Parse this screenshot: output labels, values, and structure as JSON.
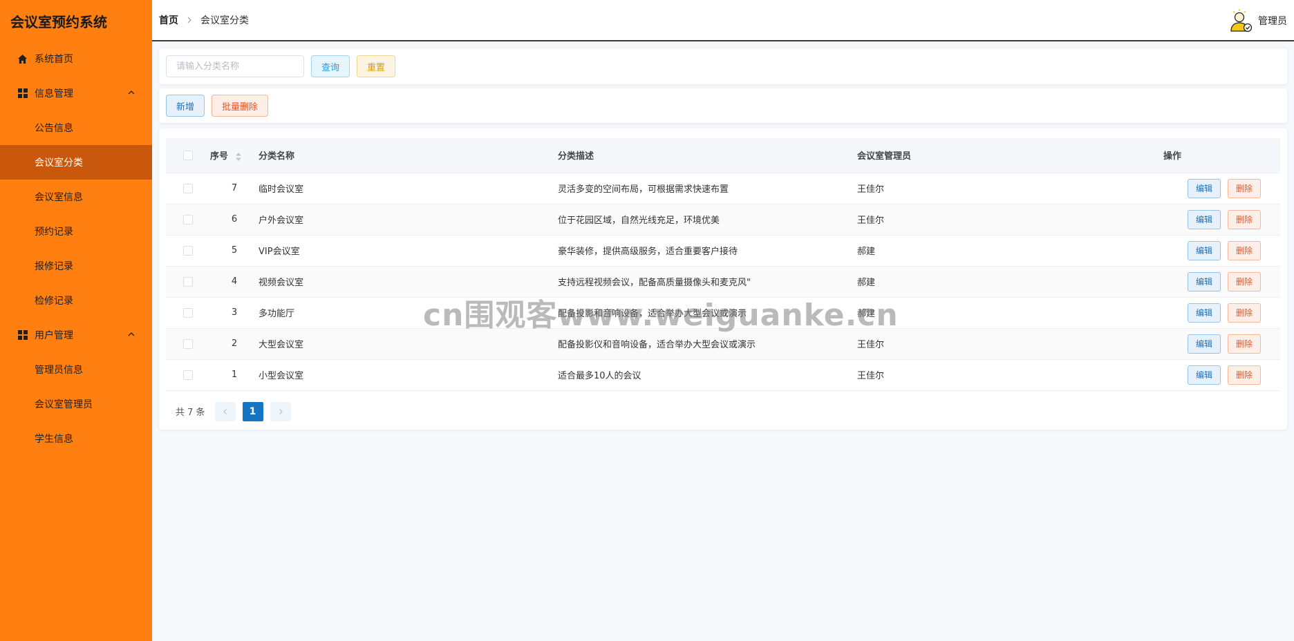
{
  "sidebar": {
    "logo": "会议室预约系统",
    "home": "系统首页",
    "groups": [
      {
        "label": "信息管理",
        "items": [
          "公告信息",
          "会议室分类",
          "会议室信息",
          "预约记录",
          "报修记录",
          "检修记录"
        ]
      },
      {
        "label": "用户管理",
        "items": [
          "管理员信息",
          "会议室管理员",
          "学生信息"
        ]
      }
    ],
    "active_item": "会议室分类"
  },
  "header": {
    "breadcrumb_home": "首页",
    "breadcrumb_current": "会议室分类",
    "user_name": "管理员",
    "user_icon": "avatar-icon"
  },
  "search": {
    "placeholder": "请输入分类名称",
    "value": "",
    "query_label": "查询",
    "reset_label": "重置"
  },
  "actions": {
    "add_label": "新增",
    "batch_delete_label": "批量删除"
  },
  "table": {
    "headers": {
      "seq": "序号",
      "name": "分类名称",
      "desc": "分类描述",
      "manager": "会议室管理员",
      "ops": "操作"
    },
    "edit_label": "编辑",
    "delete_label": "删除",
    "rows": [
      {
        "seq": "7",
        "name": "临时会议室",
        "desc": "灵活多变的空间布局，可根据需求快速布置",
        "manager": "王佳尔"
      },
      {
        "seq": "6",
        "name": "户外会议室",
        "desc": "位于花园区域，自然光线充足，环境优美",
        "manager": "王佳尔"
      },
      {
        "seq": "5",
        "name": "VIP会议室",
        "desc": "豪华装修，提供高级服务，适合重要客户接待",
        "manager": "郝建"
      },
      {
        "seq": "4",
        "name": "视频会议室",
        "desc": "支持远程视频会议，配备高质量摄像头和麦克风\"",
        "manager": "郝建"
      },
      {
        "seq": "3",
        "name": "多功能厅",
        "desc": "配备投影和音响设备，适合举办大型会议或演示",
        "manager": "郝建"
      },
      {
        "seq": "2",
        "name": "大型会议室",
        "desc": "配备投影仪和音响设备，适合举办大型会议或演示",
        "manager": "王佳尔"
      },
      {
        "seq": "1",
        "name": "小型会议室",
        "desc": "适合最多10人的会议",
        "manager": "王佳尔"
      }
    ]
  },
  "pagination": {
    "total_text": "共 7 条",
    "current_page": "1"
  },
  "watermark": "cn围观客www.weiguanke.cn",
  "colors": {
    "sidebar_bg": "#ff7f11",
    "sidebar_active": "#c9570c",
    "primary": "#1574c4"
  }
}
